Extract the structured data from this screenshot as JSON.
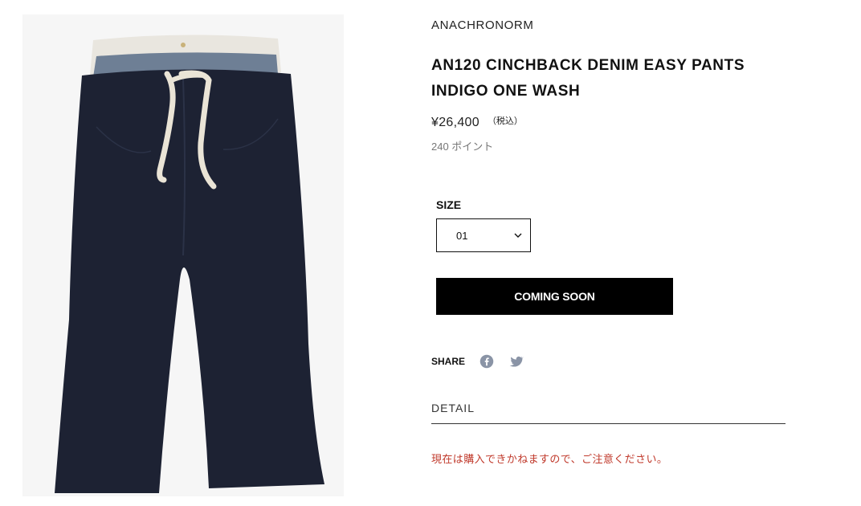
{
  "product": {
    "brand": "ANACHRONORM",
    "title_line1": "AN120 CINCHBACK DENIM EASY PANTS",
    "title_line2": "INDIGO ONE WASH",
    "price": "¥26,400",
    "tax_note": "（税込）",
    "points": "240 ポイント",
    "image_icon": "denim-pants-photo"
  },
  "size": {
    "label": "SIZE",
    "selected": "01",
    "chevron_icon": "chevron-down-icon"
  },
  "actions": {
    "coming_soon_label": "COMING SOON"
  },
  "share": {
    "label": "SHARE",
    "icons": [
      "facebook-icon",
      "twitter-icon"
    ]
  },
  "detail": {
    "label": "DETAIL",
    "notice": "現在は購入できかねますので、ご注意ください。"
  },
  "colors": {
    "button_bg": "#000000",
    "notice": "#c0392b",
    "icon_gray": "#8a94a6"
  }
}
